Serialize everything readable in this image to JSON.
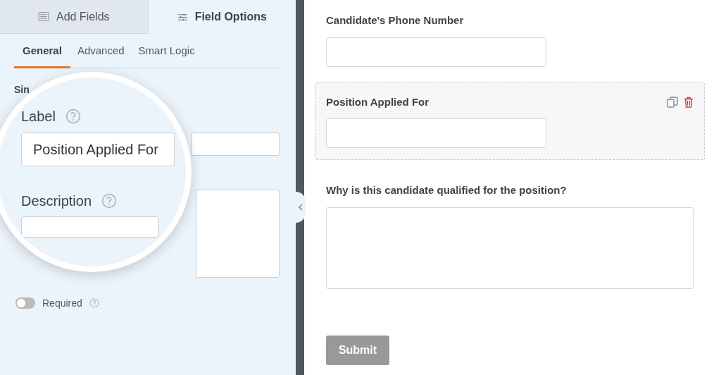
{
  "sidebar": {
    "tabs": [
      {
        "label": "Add Fields",
        "kind": "add",
        "selected": false
      },
      {
        "label": "Field Options",
        "kind": "options",
        "selected": true
      }
    ],
    "subtabs": [
      {
        "label": "General",
        "selected": true
      },
      {
        "label": "Advanced",
        "selected": false
      },
      {
        "label": "Smart Logic",
        "selected": false
      }
    ],
    "section_title": "Sin",
    "required": {
      "label": "Required",
      "on": false
    }
  },
  "magnifier": {
    "label": "Label",
    "label_value": "Position Applied For",
    "description": "Description"
  },
  "form": {
    "fields": [
      {
        "kind": "input",
        "label": "Candidate's Phone Number",
        "selected": false
      },
      {
        "kind": "input",
        "label": "Position Applied For",
        "selected": true
      },
      {
        "kind": "textarea",
        "label": "Why is this candidate qualified for the position?",
        "selected": false
      }
    ],
    "submit": "Submit"
  }
}
